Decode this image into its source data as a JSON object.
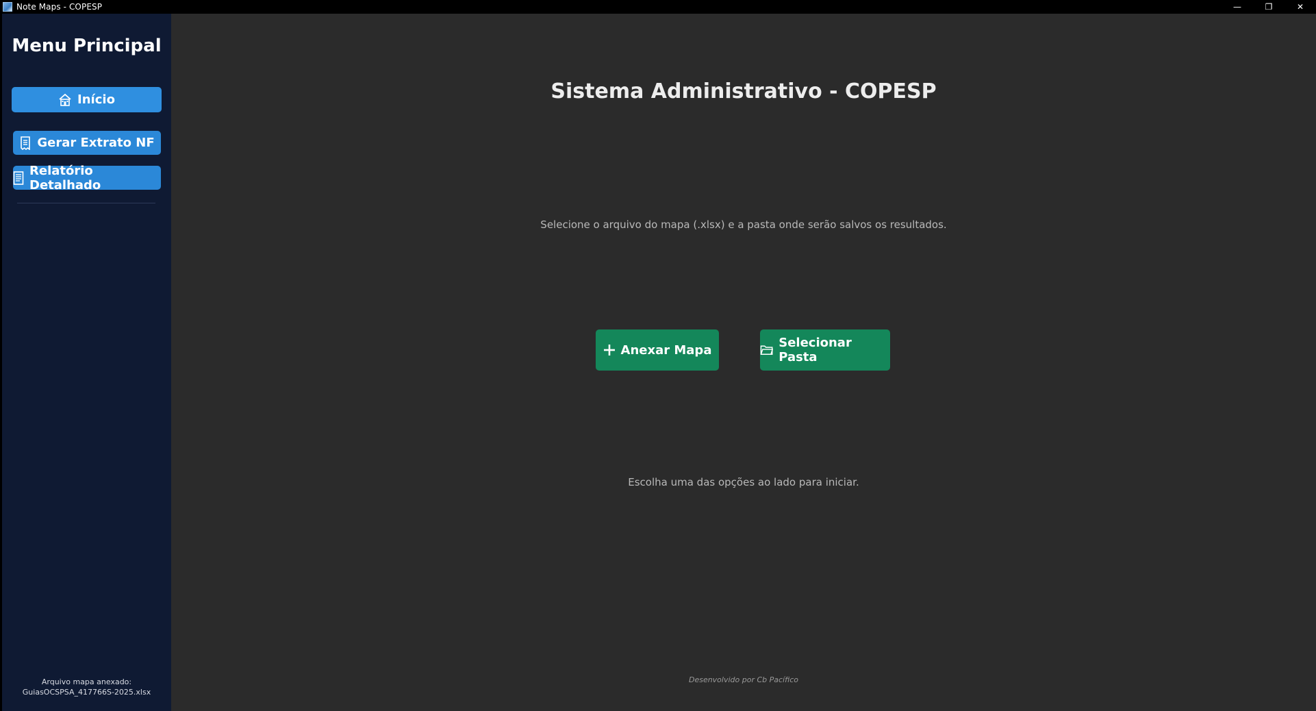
{
  "window": {
    "title": "Note Maps - COPESP",
    "controls": {
      "minimize": "—",
      "restore": "❐",
      "close": "✕"
    }
  },
  "sidebar": {
    "title": "Menu Principal",
    "buttons": [
      {
        "label": "Início",
        "icon": "home-icon"
      },
      {
        "label": "Gerar Extrato NF",
        "icon": "receipt-icon"
      },
      {
        "label": "Relatório Detalhado",
        "icon": "document-icon"
      }
    ],
    "attached_label": "Arquivo mapa anexado:",
    "attached_file": "GuiasOCSPSA_417766S-2025.xlsx"
  },
  "main": {
    "title": "Sistema Administrativo - COPESP",
    "instruction": "Selecione o arquivo do mapa (.xlsx) e a pasta onde serão salvos os resultados.",
    "buttons": {
      "anexar": {
        "label": "Anexar Mapa",
        "icon": "plus-icon"
      },
      "pasta": {
        "label": "Selecionar Pasta",
        "icon": "folder-icon"
      }
    },
    "hint": "Escolha uma das opções ao lado para iniciar.",
    "footer": "Desenvolvido por Cb Pacífico"
  },
  "colors": {
    "sidebar_bg": "#0f1a33",
    "main_bg": "#2b2b2b",
    "sidebar_button": "#2b88d8",
    "action_button": "#14875a"
  }
}
